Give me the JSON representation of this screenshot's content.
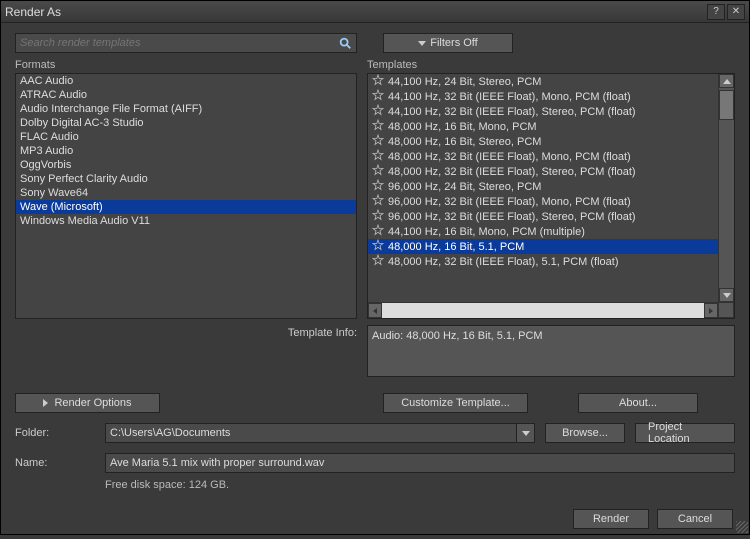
{
  "window": {
    "title": "Render As",
    "help": "?",
    "close": "✕"
  },
  "search": {
    "placeholder": "Search render templates"
  },
  "filters": {
    "label": "Filters Off"
  },
  "formats": {
    "header": "Formats",
    "items": [
      "AAC Audio",
      "ATRAC Audio",
      "Audio Interchange File Format (AIFF)",
      "Dolby Digital AC-3 Studio",
      "FLAC Audio",
      "MP3 Audio",
      "OggVorbis",
      "Sony Perfect Clarity Audio",
      "Sony Wave64",
      "Wave (Microsoft)",
      "Windows Media Audio V11"
    ],
    "selected_index": 9
  },
  "templates": {
    "header": "Templates",
    "items": [
      "44,100 Hz, 24 Bit, Stereo, PCM",
      "44,100 Hz, 32 Bit (IEEE Float), Mono, PCM (float)",
      "44,100 Hz, 32 Bit (IEEE Float), Stereo, PCM (float)",
      "48,000 Hz, 16 Bit, Mono, PCM",
      "48,000 Hz, 16 Bit, Stereo, PCM",
      "48,000 Hz, 32 Bit (IEEE Float), Mono, PCM (float)",
      "48,000 Hz, 32 Bit (IEEE Float), Stereo, PCM (float)",
      "96,000 Hz, 24 Bit, Stereo, PCM",
      "96,000 Hz, 32 Bit (IEEE Float), Mono, PCM (float)",
      "96,000 Hz, 32 Bit (IEEE Float), Stereo, PCM (float)",
      "44,100 Hz, 16 Bit, Mono, PCM (multiple)",
      "48,000 Hz, 16 Bit, 5.1, PCM",
      "48,000 Hz, 32 Bit (IEEE Float), 5.1, PCM (float)"
    ],
    "selected_index": 11
  },
  "template_info": {
    "label": "Template Info:",
    "text": "Audio: 48,000 Hz, 16 Bit, 5.1, PCM"
  },
  "buttons": {
    "render_options": "Render Options",
    "customize": "Customize Template...",
    "about": "About...",
    "browse": "Browse...",
    "project_location": "Project Location",
    "render": "Render",
    "cancel": "Cancel"
  },
  "folder": {
    "label": "Folder:",
    "value": "C:\\Users\\AG\\Documents"
  },
  "name": {
    "label": "Name:",
    "value": "Ave Maria 5.1 mix with proper surround.wav"
  },
  "free_space": "Free disk space: 124 GB."
}
